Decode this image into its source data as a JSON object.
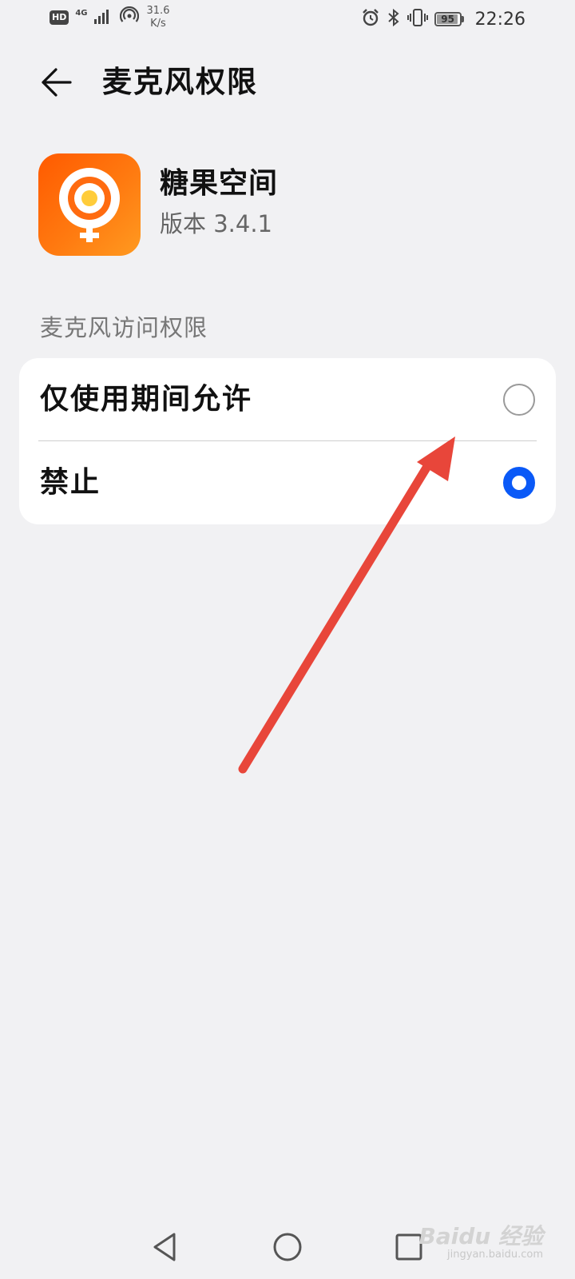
{
  "status_bar": {
    "hd_label": "HD",
    "network_type": "4G",
    "speed_value": "31.6",
    "speed_unit": "K/s",
    "battery_level": "95",
    "time": "22:26"
  },
  "header": {
    "title": "麦克风权限"
  },
  "app": {
    "name": "糖果空间",
    "version": "版本 3.4.1",
    "icon_colors": [
      "#ff5a00",
      "#ff9a20"
    ]
  },
  "section": {
    "label": "麦克风访问权限"
  },
  "options": [
    {
      "label": "仅使用期间允许",
      "selected": false
    },
    {
      "label": "禁止",
      "selected": true
    }
  ],
  "colors": {
    "accent": "#0a59f7",
    "annotation_arrow": "#e8463a",
    "background": "#f1f1f3"
  },
  "watermark": {
    "brand": "Baidu 经验",
    "sub": "jingyan.baidu.com"
  }
}
